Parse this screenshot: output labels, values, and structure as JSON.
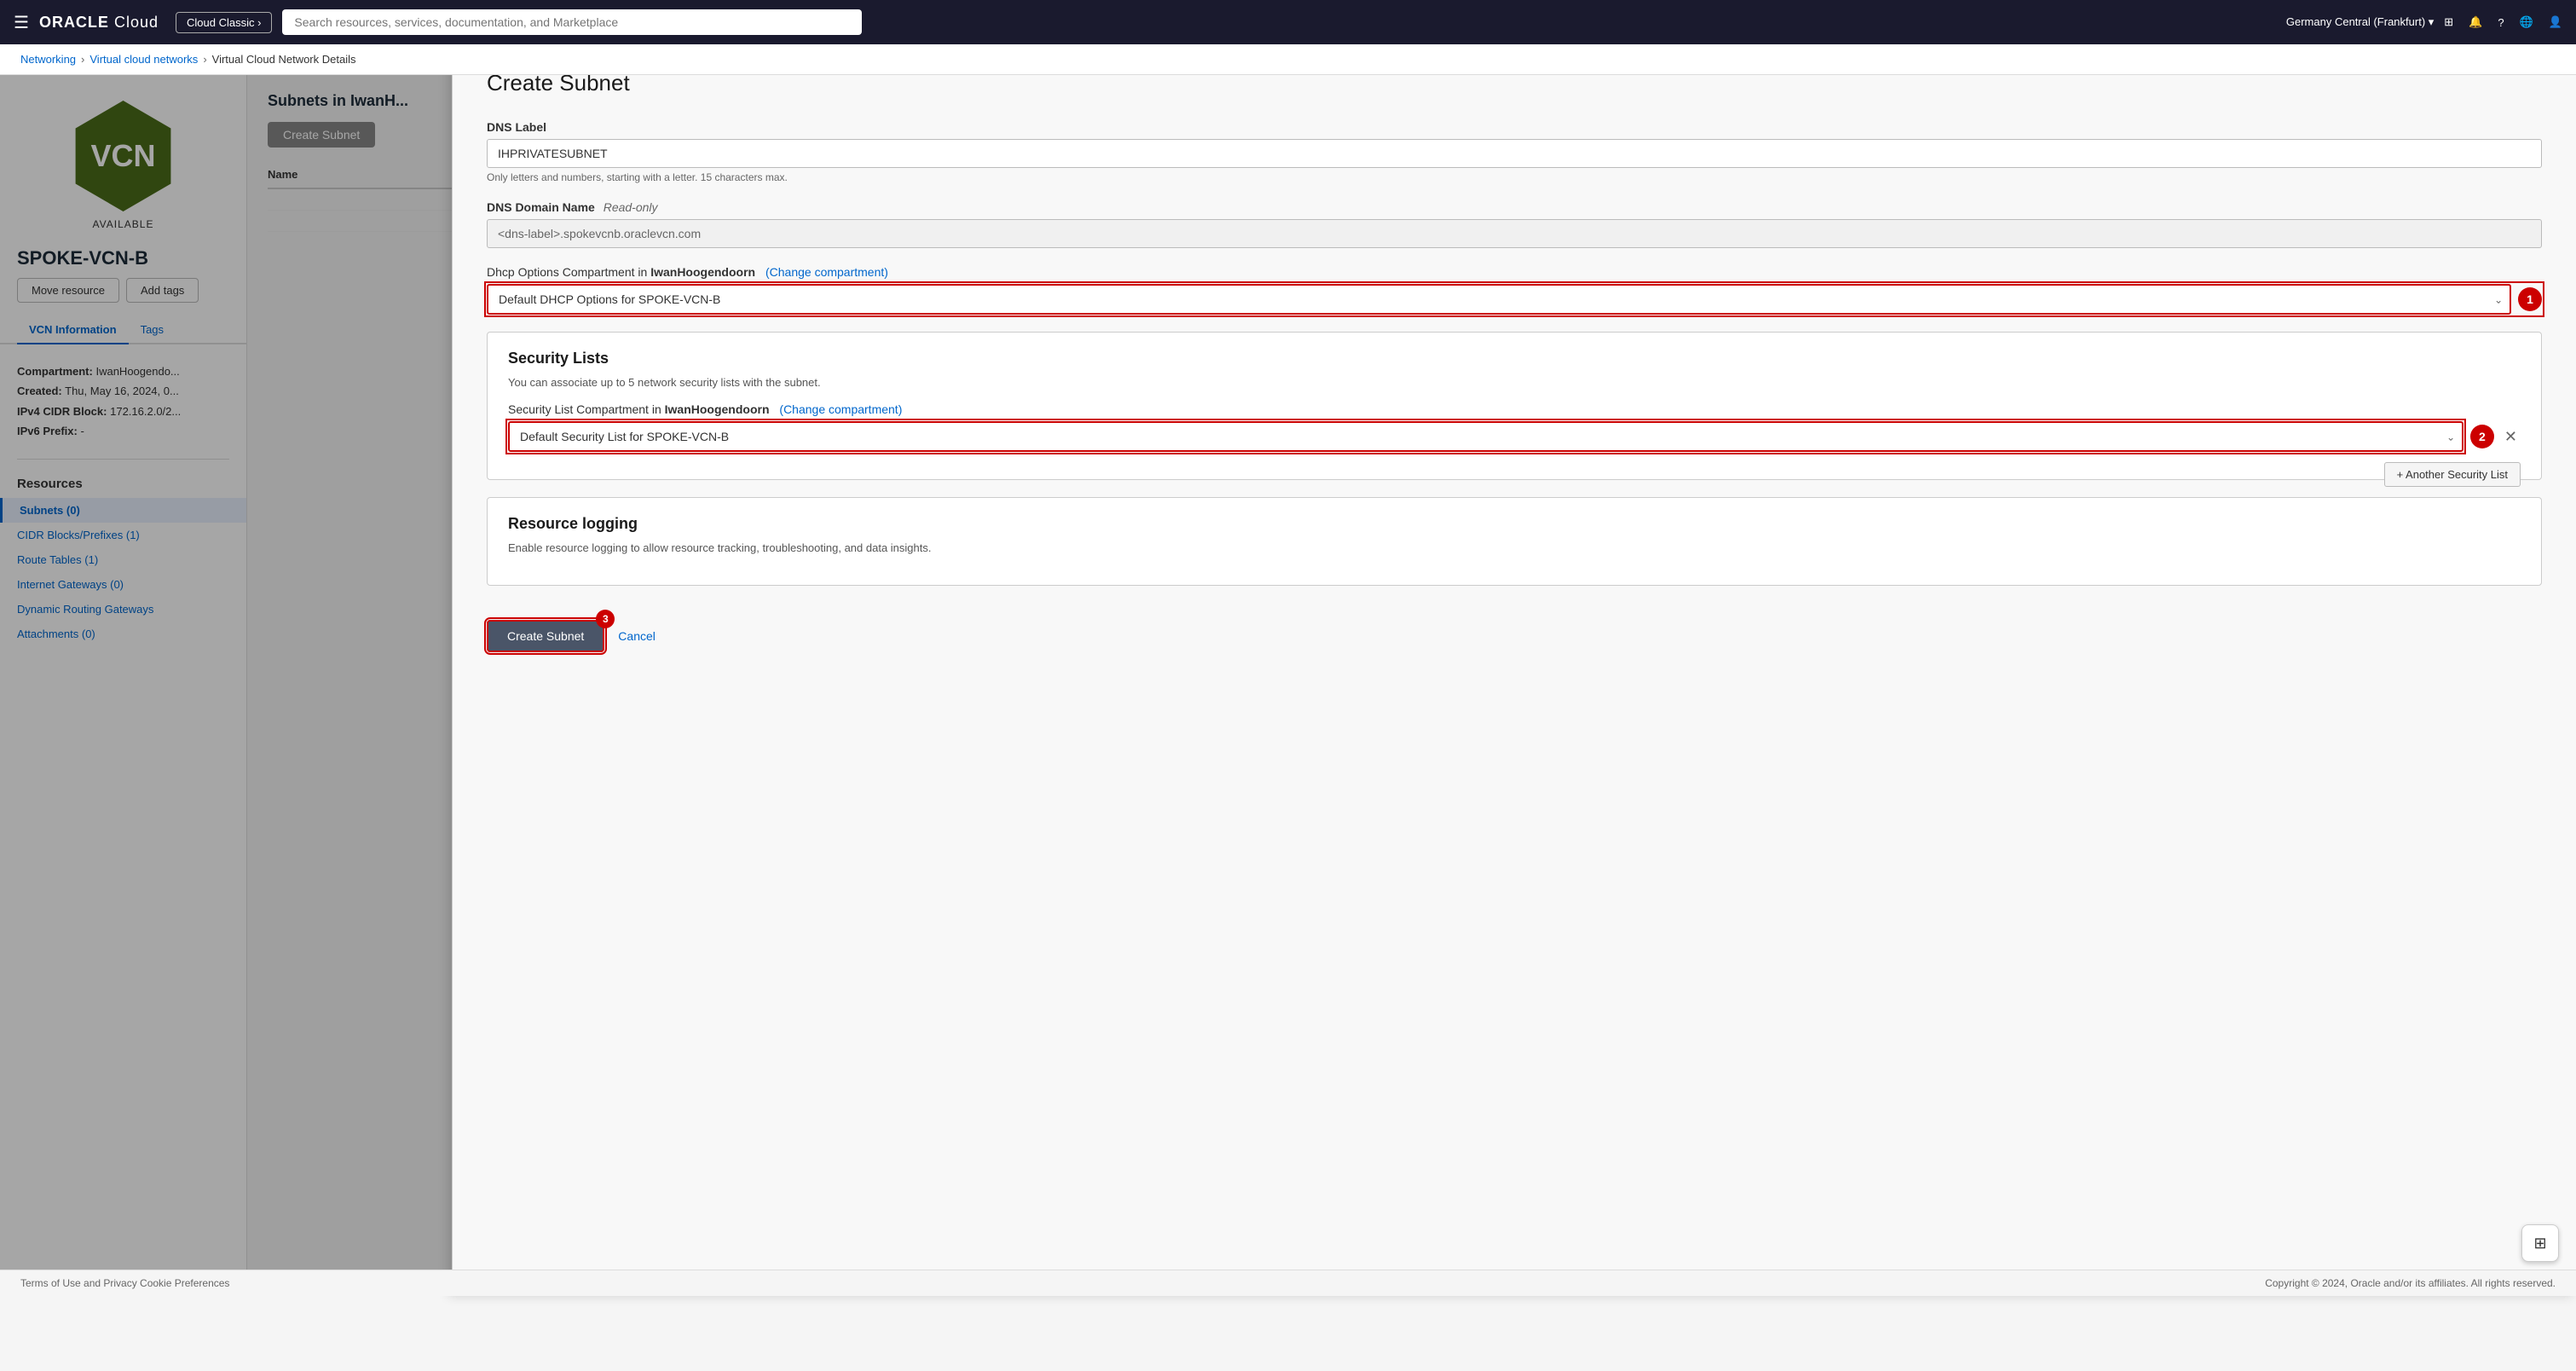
{
  "topnav": {
    "logo": "ORACLE",
    "logo_suffix": " Cloud",
    "cloud_classic_label": "Cloud Classic ›",
    "search_placeholder": "Search resources, services, documentation, and Marketplace",
    "region": "Germany Central (Frankfurt) ▾"
  },
  "breadcrumb": {
    "networking": "Networking",
    "vcn_list": "Virtual cloud networks",
    "detail": "Virtual Cloud Network Details"
  },
  "vcn": {
    "icon_text": "VCN",
    "status": "AVAILABLE",
    "title": "SPOKE-VCN-B",
    "btn_move": "Move resource",
    "btn_add_tags": "Add tags",
    "tab_vcn_info": "VCN Information",
    "tab_tags": "Tags",
    "compartment_label": "Compartment:",
    "compartment_value": "IwanHoogendo...",
    "created_label": "Created:",
    "created_value": "Thu, May 16, 2024, 0...",
    "ipv4_label": "IPv4 CIDR Block:",
    "ipv4_value": "172.16.2.0/2...",
    "ipv6_label": "IPv6 Prefix:",
    "ipv6_value": "-"
  },
  "resources": {
    "title": "Resources",
    "items": [
      {
        "label": "Subnets (0)",
        "id": "subnets",
        "active": true
      },
      {
        "label": "CIDR Blocks/Prefixes (1)",
        "id": "cidr"
      },
      {
        "label": "Route Tables (1)",
        "id": "routes"
      },
      {
        "label": "Internet Gateways (0)",
        "id": "igw"
      },
      {
        "label": "Dynamic Routing Gateways",
        "id": "drg"
      },
      {
        "label": "Attachments (0)",
        "id": "attachments"
      }
    ]
  },
  "main": {
    "subnets_title": "Subnets in IwanH...",
    "create_btn": "Create Subnet",
    "table_col_name": "Name"
  },
  "panel": {
    "title": "Create Subnet",
    "dns_label_field": "DNS Label",
    "dns_label_value": "IHPRIVATESUBNET",
    "dns_hint": "Only letters and numbers, starting with a letter. 15 characters max.",
    "dns_domain_label": "DNS Domain Name",
    "dns_domain_readonly": "Read-only",
    "dns_domain_value": "<dns-label>.spokevcnb.oraclevcn.com",
    "dhcp_compartment_label": "Dhcp Options Compartment in",
    "dhcp_compartment_bold": "IwanHoogendoorn",
    "dhcp_change": "(Change compartment)",
    "dhcp_select_value": "Default DHCP Options for SPOKE-VCN-B",
    "security_lists_title": "Security Lists",
    "security_lists_desc": "You can associate up to 5 network security lists with the subnet.",
    "security_compartment_label": "Security List Compartment in",
    "security_compartment_bold": "IwanHoogendoorn",
    "security_change": "(Change compartment)",
    "security_select_value": "Default Security List for SPOKE-VCN-B",
    "add_security_btn": "+ Another Security List",
    "resource_logging_title": "Resource logging",
    "resource_logging_desc": "Enable resource logging to allow resource tracking, troubleshooting, and data insights.",
    "create_btn": "Create Subnet",
    "cancel_btn": "Cancel"
  },
  "footer": {
    "left": "Terms of Use and Privacy    Cookie Preferences",
    "right": "Copyright © 2024, Oracle and/or its affiliates. All rights reserved."
  }
}
